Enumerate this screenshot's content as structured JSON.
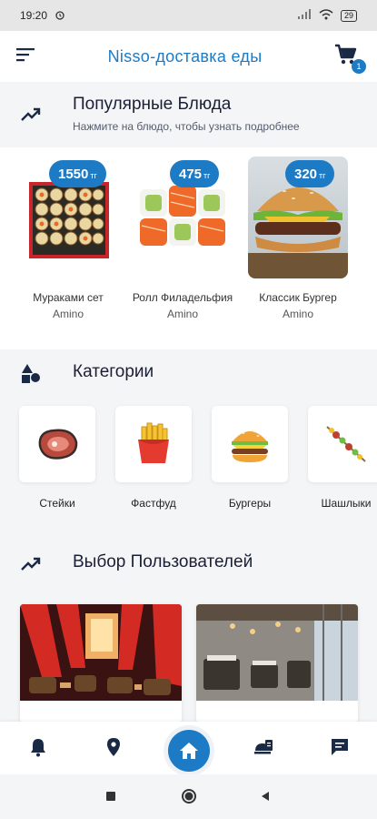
{
  "status": {
    "time": "19:20",
    "battery": "29"
  },
  "header": {
    "title": "Nisso-доставка еды",
    "cart_count": "1"
  },
  "popular": {
    "title": "Популярные Блюда",
    "subtitle": "Нажмите на блюдо, чтобы узнать подробнее",
    "items": [
      {
        "name": "Мураками сет",
        "shop": "Amino",
        "price": "1550",
        "currency": "тг"
      },
      {
        "name": "Ролл Филадельфия",
        "shop": "Amino",
        "price": "475",
        "currency": "тг"
      },
      {
        "name": "Классик Бургер",
        "shop": "Amino",
        "price": "320",
        "currency": "тг"
      }
    ]
  },
  "categories": {
    "title": "Категории",
    "items": [
      {
        "label": "Стейки",
        "icon": "steak-icon"
      },
      {
        "label": "Фастфуд",
        "icon": "fries-icon"
      },
      {
        "label": "Бургеры",
        "icon": "burger-icon"
      },
      {
        "label": "Шашлыки",
        "icon": "kebab-icon"
      }
    ]
  },
  "users_choice": {
    "title": "Выбор Пользователей"
  },
  "nav": {
    "items": [
      "bell-icon",
      "location-icon",
      "home-icon",
      "dishes-icon",
      "chat-icon"
    ]
  },
  "colors": {
    "accent": "#1d7ac5",
    "background": "#f4f5f7"
  }
}
